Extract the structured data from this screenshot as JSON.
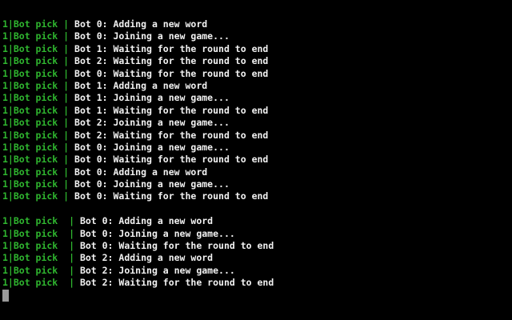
{
  "terminal": {
    "background": "#000000",
    "prefix_color": "#2fb52f",
    "text_color": "#f2f2f2",
    "block1": [
      {
        "prefix": "1|Bot pick | ",
        "msg": "Bot 0: Adding a new word"
      },
      {
        "prefix": "1|Bot pick | ",
        "msg": "Bot 0: Joining a new game..."
      },
      {
        "prefix": "1|Bot pick | ",
        "msg": "Bot 1: Waiting for the round to end"
      },
      {
        "prefix": "1|Bot pick | ",
        "msg": "Bot 2: Waiting for the round to end"
      },
      {
        "prefix": "1|Bot pick | ",
        "msg": "Bot 0: Waiting for the round to end"
      },
      {
        "prefix": "1|Bot pick | ",
        "msg": "Bot 1: Adding a new word"
      },
      {
        "prefix": "1|Bot pick | ",
        "msg": "Bot 1: Joining a new game..."
      },
      {
        "prefix": "1|Bot pick | ",
        "msg": "Bot 1: Waiting for the round to end"
      },
      {
        "prefix": "1|Bot pick | ",
        "msg": "Bot 2: Joining a new game..."
      },
      {
        "prefix": "1|Bot pick | ",
        "msg": "Bot 2: Waiting for the round to end"
      },
      {
        "prefix": "1|Bot pick | ",
        "msg": "Bot 0: Joining a new game..."
      },
      {
        "prefix": "1|Bot pick | ",
        "msg": "Bot 0: Waiting for the round to end"
      },
      {
        "prefix": "1|Bot pick | ",
        "msg": "Bot 0: Adding a new word"
      },
      {
        "prefix": "1|Bot pick | ",
        "msg": "Bot 0: Joining a new game..."
      },
      {
        "prefix": "1|Bot pick | ",
        "msg": "Bot 0: Waiting for the round to end"
      }
    ],
    "block2": [
      {
        "prefix": "1|Bot pick  | ",
        "msg": "Bot 0: Adding a new word"
      },
      {
        "prefix": "1|Bot pick  | ",
        "msg": "Bot 0: Joining a new game..."
      },
      {
        "prefix": "1|Bot pick  | ",
        "msg": "Bot 0: Waiting for the round to end"
      },
      {
        "prefix": "1|Bot pick  | ",
        "msg": "Bot 2: Adding a new word"
      },
      {
        "prefix": "1|Bot pick  | ",
        "msg": "Bot 2: Joining a new game..."
      },
      {
        "prefix": "1|Bot pick  | ",
        "msg": "Bot 2: Waiting for the round to end"
      }
    ]
  }
}
